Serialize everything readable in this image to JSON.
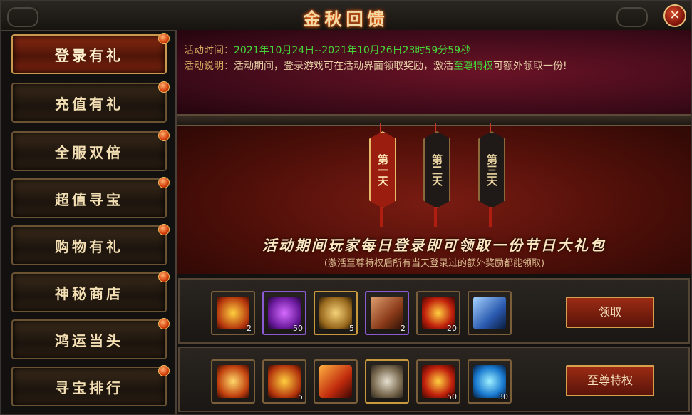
{
  "window": {
    "title": "金秋回馈",
    "close_label": "✕"
  },
  "sidebar": {
    "items": [
      {
        "label": "登录有礼",
        "active": true
      },
      {
        "label": "充值有礼",
        "active": false
      },
      {
        "label": "全服双倍",
        "active": false
      },
      {
        "label": "超值寻宝",
        "active": false
      },
      {
        "label": "购物有礼",
        "active": false
      },
      {
        "label": "神秘商店",
        "active": false
      },
      {
        "label": "鸿运当头",
        "active": false
      },
      {
        "label": "寻宝排行",
        "active": false
      }
    ]
  },
  "info": {
    "time_label": "活动时间：",
    "time_value": "2021年10月24日--2021年10月26日23时59分59秒",
    "desc_label": "活动说明：",
    "desc_before": "活动期间，登录游戏可在活动界面领取奖励，激活",
    "desc_highlight": "至尊特权",
    "desc_after": "可额外领取一份!"
  },
  "banner": {
    "days": [
      {
        "label": "第一天",
        "active": true
      },
      {
        "label": "第二天",
        "active": false
      },
      {
        "label": "第三天",
        "active": false
      }
    ],
    "headline": "活动期间玩家每日登录即可领取一份节日大礼包",
    "subline": "(激活至尊特权后所有当天登录过的额外奖励都能领取)"
  },
  "rewards": {
    "row1": {
      "button_label": "领取",
      "items": [
        {
          "icon": "golden-key-icon",
          "count": "2"
        },
        {
          "icon": "purple-orb-icon",
          "count": "50"
        },
        {
          "icon": "horn-icon",
          "count": "5"
        },
        {
          "icon": "scroll-roll-icon",
          "count": "2"
        },
        {
          "icon": "red-medal-icon",
          "count": "20"
        },
        {
          "icon": "blue-scroll-icon",
          "count": ""
        }
      ]
    },
    "row2": {
      "button_label": "至尊特权",
      "items": [
        {
          "icon": "treasure-chest-icon",
          "count": ""
        },
        {
          "icon": "golden-key-icon",
          "count": "5"
        },
        {
          "icon": "fire-scroll-icon",
          "count": ""
        },
        {
          "icon": "silver-chest-icon",
          "count": ""
        },
        {
          "icon": "red-medal-icon",
          "count": "50"
        },
        {
          "icon": "blue-gem-icon",
          "count": "30"
        }
      ]
    }
  },
  "colors": {
    "accent_gold": "#d9a04c",
    "active_red": "#8a2a12",
    "highlight_green": "#46d83a",
    "info_bg": "#4a0e1c"
  }
}
